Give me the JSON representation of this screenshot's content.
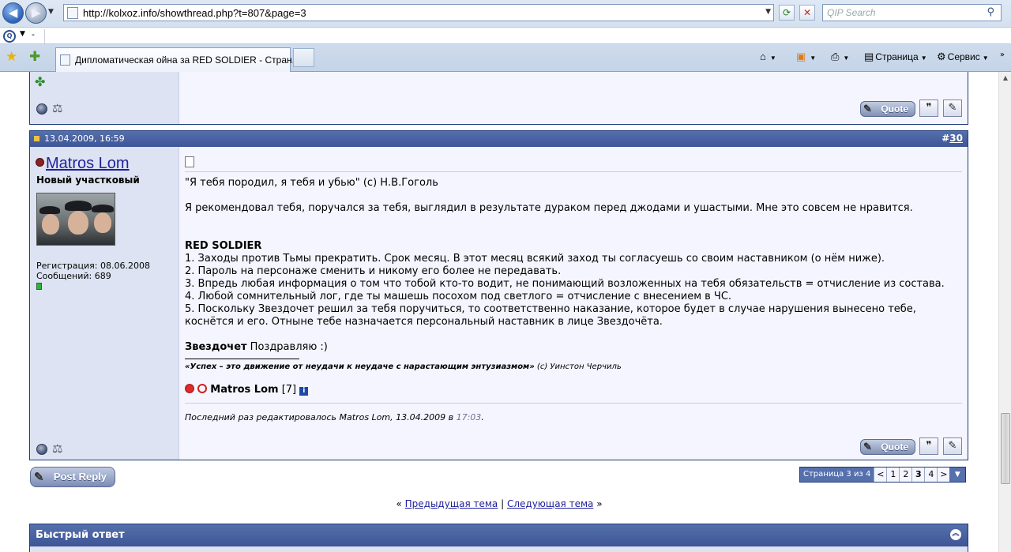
{
  "browser": {
    "url": "http://kolxoz.info/showthread.php?t=807&page=3",
    "search_placeholder": "QIP Search",
    "qip_dash": "-",
    "tab_title": "Дипломатическая ойна за RED SOLDIER - Стран...",
    "page_menu": "Страница",
    "tools_menu": "Сервис"
  },
  "prev_post": {
    "quote_label": "Quote"
  },
  "post": {
    "date": "13.04.2009, 16:59",
    "number_prefix": "#",
    "number": "30",
    "author": "Matros Lom",
    "user_title": "Новый участковый",
    "registration": "Регистрация: 08.06.2008",
    "messages": "Сообщений: 689",
    "lines": [
      "\"Я тебя породил, я тебя и убью\" (с) Н.В.Гоголь",
      "Я рекомендовал тебя, поручался за тебя, выглядил в результате дураком перед джодами и ушастыми. Мне это совсем не нравится.",
      "RED SOLDIER",
      "1. Заходы против Тьмы прекратить. Срок месяц. В этот месяц всякий заход ты согласуешь со своим наставником (о нём ниже).",
      "2. Пароль на персонаже сменить и никому его более не передавать.",
      "3. Впредь любая информация о том что тобой кто-то водит, не понимающий возложенных на тебя обязательств = отчисление из состава.",
      "4. Любой сомнительный лог, где ты машешь посохом под светлого = отчисление с внесением в ЧС.",
      "5. Поскольку Звездочет решил за тебя поручиться, то соответственно наказание, которое будет в случае нарушения вынесено тебе,",
      "коснётся и его. Отныне тебе назначается персональный наставник в лице Звездочёта."
    ],
    "congrats_name": "Звездочет",
    "congrats_text": " Поздравляю :)",
    "signature_quote": "«Успех – это движение от неудачи к неудаче с нарастающим энтузиазмом»",
    "signature_author": " (с) Уинстон Черчиль",
    "sig_name": "Matros Lom",
    "sig_level": " [7]",
    "info_glyph": "i",
    "edited_text": "Последний раз редактировалось Matros Lom, 13.04.2009 в ",
    "edited_time": "17:03",
    "edited_dot": ".",
    "quote_label": "Quote"
  },
  "bottom": {
    "post_reply": "Post Reply",
    "pager_label": "Страница 3 из 4",
    "pages": [
      "<",
      "1",
      "2",
      "3",
      "4",
      ">"
    ],
    "current_page": "3",
    "prev_thread": "Предыдущая тема",
    "next_thread": "Следующая тема",
    "nav_left": "« ",
    "nav_sep": " | ",
    "nav_right": " »",
    "quick_reply": "Быстрый ответ"
  },
  "colors": {
    "header_blue": "#3e5597",
    "post_bg": "#f5f5ff",
    "sidebar_bg": "#dde3f2",
    "link": "#22229c"
  }
}
